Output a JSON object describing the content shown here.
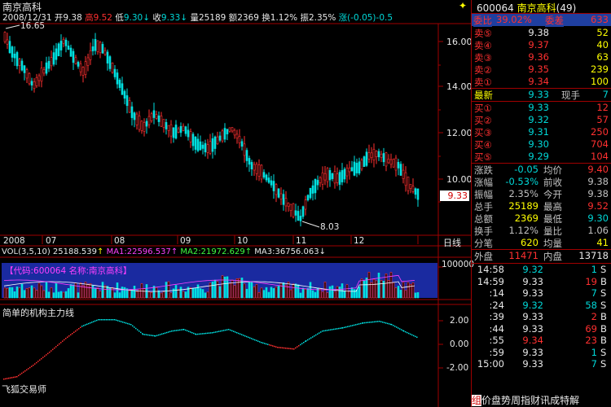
{
  "stock": {
    "name": "南京高科",
    "code": "600064",
    "count_label": "(49)"
  },
  "info_bar": {
    "date": "2008/12/31",
    "open_label": "开",
    "open": "9.38",
    "high_label": "高",
    "high": "9.52",
    "low_label": "低",
    "low": "9.30",
    "close_label": "收",
    "close": "9.33",
    "vol_label": "量",
    "vol": "25189",
    "amt_label": "额",
    "amt": "2369",
    "turn_label": "换",
    "turn": "1.12%",
    "amp_label": "振",
    "amp": "2.35%",
    "chg_label": "涨",
    "chg": "(-0.05)-0.5"
  },
  "price_chart": {
    "y_ticks": [
      "16.00",
      "14.00",
      "12.00",
      "10.00"
    ],
    "max_label": "16.65",
    "min_label": "8.03",
    "current_price_tag": "9.33"
  },
  "x_axis": {
    "months": [
      "2008",
      "07",
      "08",
      "09",
      "10",
      "11",
      "12"
    ],
    "period": "日线"
  },
  "volume_panel": {
    "header_vol": "VOL(3,5,10)",
    "vol_value": "25188.539",
    "ma1": "MA1:22596.537",
    "ma2": "MA2:21972.629",
    "ma3": "MA3:36756.063",
    "overlay_text": "【代码:600064 名称:南京高科】",
    "y_tick": "100000"
  },
  "indicator_panel": {
    "title": "简单的机构主力线",
    "y_ticks": [
      "2.00",
      "0.00",
      "-2.00"
    ],
    "brand": "飞狐交易师"
  },
  "quote_panel": {
    "weibi_label": "委比",
    "weibi": "39.02%",
    "weicha_label": "委差",
    "weicha": "633",
    "asks": [
      {
        "label": "卖⑤",
        "price": "9.38",
        "vol": "52"
      },
      {
        "label": "卖④",
        "price": "9.37",
        "vol": "40"
      },
      {
        "label": "卖③",
        "price": "9.36",
        "vol": "63"
      },
      {
        "label": "卖②",
        "price": "9.35",
        "vol": "239"
      },
      {
        "label": "卖①",
        "price": "9.34",
        "vol": "100"
      }
    ],
    "last_label": "最新",
    "last": "9.33",
    "xianshou_label": "现手",
    "xianshou": "7",
    "bids": [
      {
        "label": "买①",
        "price": "9.33",
        "vol": "12"
      },
      {
        "label": "买②",
        "price": "9.32",
        "vol": "57"
      },
      {
        "label": "买③",
        "price": "9.31",
        "vol": "250"
      },
      {
        "label": "买④",
        "price": "9.30",
        "vol": "704"
      },
      {
        "label": "买⑤",
        "price": "9.29",
        "vol": "104"
      }
    ],
    "stats": [
      {
        "l1": "涨跌",
        "v1": "-0.05",
        "l2": "均价",
        "v2": "9.40"
      },
      {
        "l1": "涨幅",
        "v1": "-0.53%",
        "l2": "前收",
        "v2": "9.38"
      },
      {
        "l1": "振幅",
        "v1": "2.35%",
        "l2": "今开",
        "v2": "9.38"
      },
      {
        "l1": "总手",
        "v1": "25189",
        "l2": "最高",
        "v2": "9.52"
      },
      {
        "l1": "总额",
        "v1": "2369",
        "l2": "最低",
        "v2": "9.30"
      },
      {
        "l1": "换手",
        "v1": "1.12%",
        "l2": "量比",
        "v2": "1.06"
      },
      {
        "l1": "分笔",
        "v1": "620",
        "l2": "均量",
        "v2": "41"
      }
    ],
    "waipan_label": "外盘",
    "waipan": "11471",
    "neipan_label": "内盘",
    "neipan": "13718",
    "ticks": [
      {
        "t": "14:58",
        "p": "9.32",
        "v": "1",
        "s": "S"
      },
      {
        "t": "14:59",
        "p": "9.33",
        "v": "19",
        "s": "B"
      },
      {
        "t": ":14",
        "p": "9.33",
        "v": "7",
        "s": "S"
      },
      {
        "t": ":24",
        "p": "9.32",
        "v": "58",
        "s": "S"
      },
      {
        "t": ":39",
        "p": "9.33",
        "v": "2",
        "s": "B"
      },
      {
        "t": ":44",
        "p": "9.33",
        "v": "69",
        "s": "B"
      },
      {
        "t": ":55",
        "p": "9.34",
        "v": "23",
        "s": "B"
      },
      {
        "t": ":59",
        "p": "9.33",
        "v": "1",
        "s": "S"
      },
      {
        "t": "15:00",
        "p": "9.33",
        "v": "7",
        "s": "S"
      }
    ],
    "bottom_tabs": [
      "价",
      "盘",
      "势",
      "周",
      "指",
      "财",
      "讯",
      "成",
      "特",
      "解"
    ],
    "bottom_prefix": "组"
  }
}
